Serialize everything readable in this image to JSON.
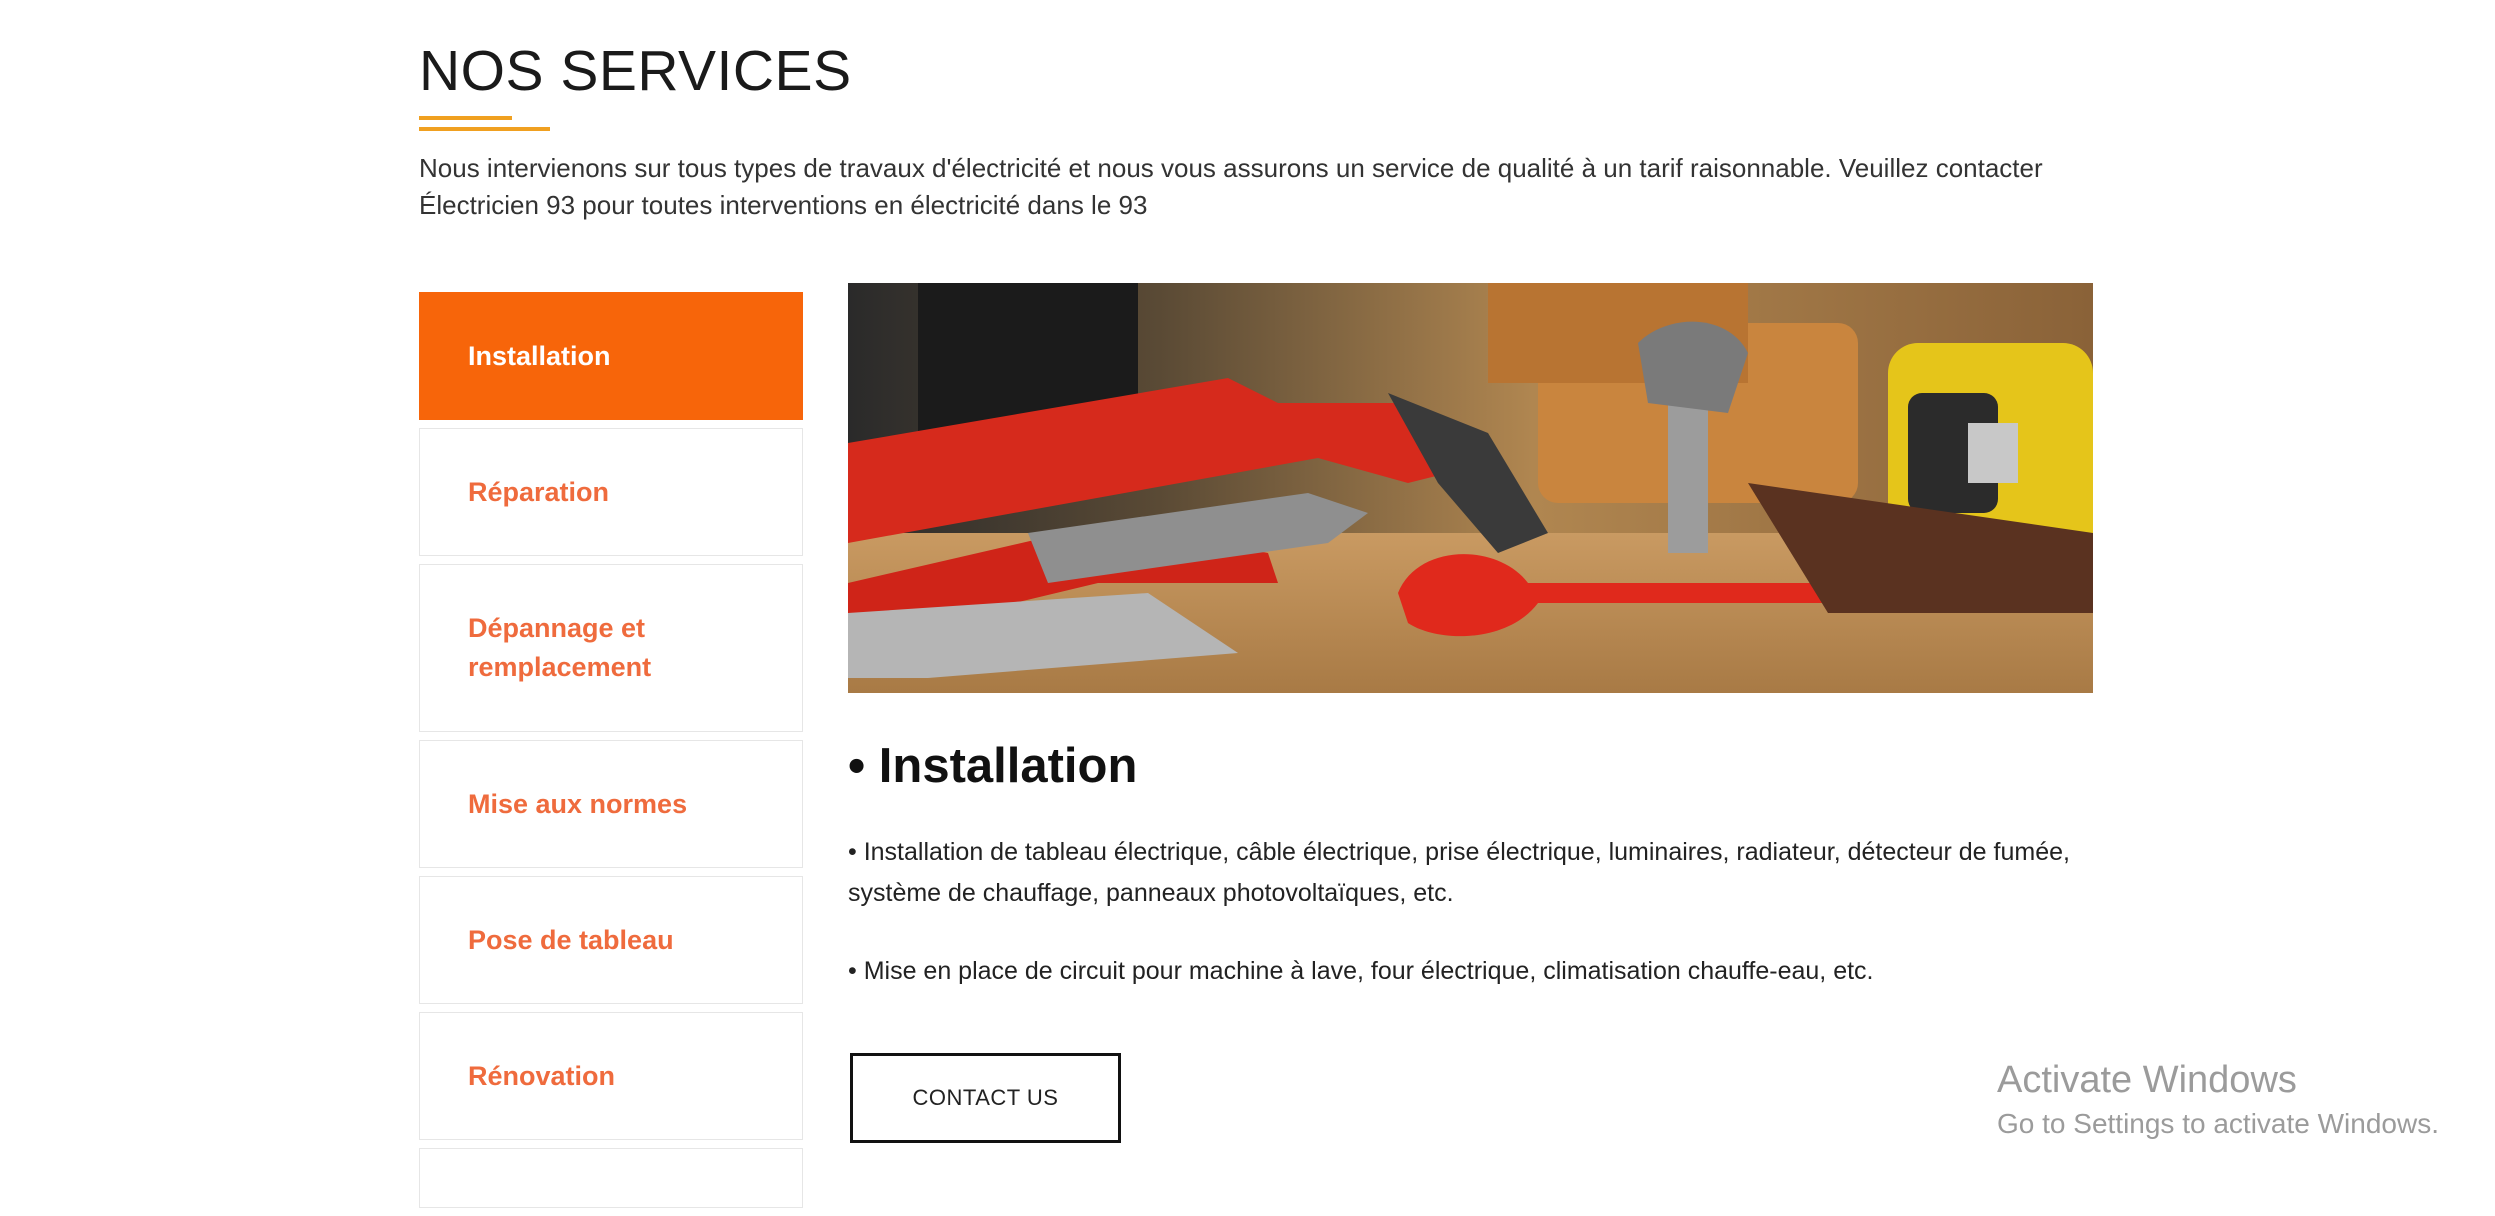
{
  "header": {
    "title": "NOS SERVICES",
    "intro": "Nous intervienons sur tous types de travaux d'électricité et nous vous assurons un service de qualité à un tarif raisonnable. Veuillez contacter Électricien 93 pour toutes interventions en électricité dans le 93"
  },
  "tabs": [
    {
      "label": "Installation",
      "active": true
    },
    {
      "label": "Réparation"
    },
    {
      "label": "Dépannage et remplacement"
    },
    {
      "label": "Mise aux normes"
    },
    {
      "label": "Pose de tableau"
    },
    {
      "label": "Rénovation"
    },
    {
      "label": ""
    }
  ],
  "content": {
    "title": "• Installation",
    "paragraph1": "• Installation de tableau électrique, câble électrique, prise électrique, luminaires, radiateur, détecteur de fumée, système de chauffage, panneaux photovoltaïques, etc.",
    "paragraph2": "• Mise en place de circuit pour machine à lave, four électrique, climatisation chauffe-eau, etc.",
    "cta_label": "CONTACT US"
  },
  "watermark": {
    "line1": "Activate Windows",
    "line2": "Go to Settings to activate Windows."
  },
  "colors": {
    "accent_orange": "#f7650a",
    "tab_text": "#ef6b3d",
    "underline": "#f0a020"
  }
}
